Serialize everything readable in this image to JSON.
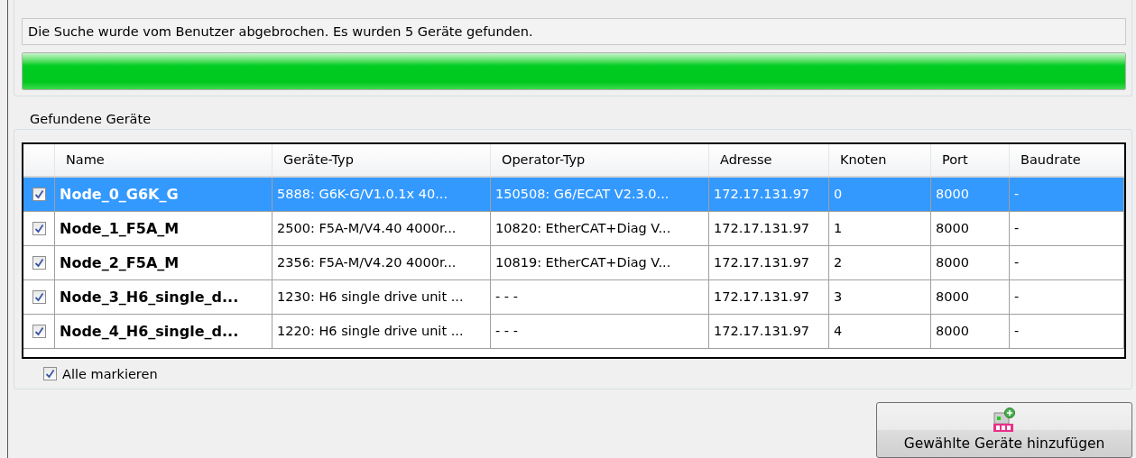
{
  "status_message": "Die Suche wurde vom Benutzer abgebrochen. Es wurden 5 Geräte gefunden.",
  "progress": {
    "level": 1
  },
  "group": {
    "title": "Gefundene Geräte",
    "table": {
      "columns": [
        "Name",
        "Geräte-Typ",
        "Operator-Typ",
        "Adresse",
        "Knoten",
        "Port",
        "Baudrate"
      ],
      "rows": [
        {
          "checked": true,
          "selected": true,
          "cells": [
            "Node_0_G6K_G",
            "5888: G6K-G/V1.0.1x 40...",
            "150508: G6/ECAT V2.3.0...",
            "172.17.131.97",
            "0",
            "8000",
            "-"
          ]
        },
        {
          "checked": true,
          "selected": false,
          "cells": [
            "Node_1_F5A_M",
            "2500: F5A-M/V4.40 4000r...",
            "10820: EtherCAT+Diag V...",
            "172.17.131.97",
            "1",
            "8000",
            "-"
          ]
        },
        {
          "checked": true,
          "selected": false,
          "cells": [
            "Node_2_F5A_M",
            "2356: F5A-M/V4.20 4000r...",
            "10819: EtherCAT+Diag V...",
            "172.17.131.97",
            "2",
            "8000",
            "-"
          ]
        },
        {
          "checked": true,
          "selected": false,
          "cells": [
            "Node_3_H6_single_d...",
            "1230: H6 single drive unit ...",
            "- - -",
            "172.17.131.97",
            "3",
            "8000",
            "-"
          ]
        },
        {
          "checked": true,
          "selected": false,
          "cells": [
            "Node_4_H6_single_d...",
            "1220: H6 single drive unit ...",
            "- - -",
            "172.17.131.97",
            "4",
            "8000",
            "-"
          ]
        }
      ]
    },
    "select_all": {
      "label": "Alle markieren",
      "checked": true
    }
  },
  "add_button": {
    "label": "Gewählte Geräte hinzufügen"
  }
}
